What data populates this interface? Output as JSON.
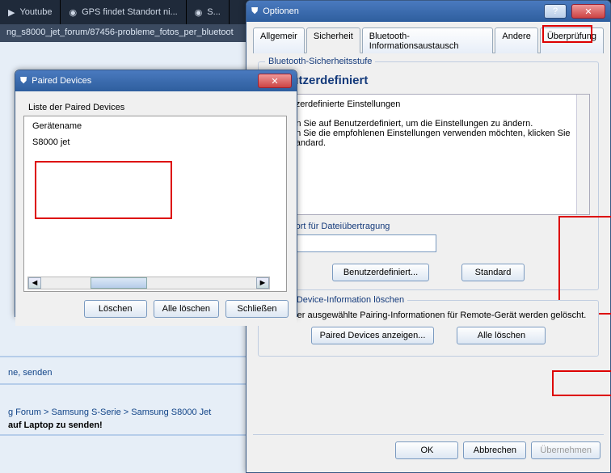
{
  "browser": {
    "tabs": [
      {
        "label": "Youtube",
        "icon": "youtube-icon"
      },
      {
        "label": "GPS findet Standort ni...",
        "icon": "globe-icon"
      },
      {
        "label": "S...",
        "icon": "globe-icon"
      }
    ],
    "url_fragment": "ng_s8000_jet_forum/87456-probleme_fotos_per_bluetoot"
  },
  "bg": {
    "tags": "ne, senden",
    "crumb1": "g Forum",
    "crumb2": "Samsung S-Serie",
    "crumb3": "Samsung S8000 Jet",
    "headline": "auf Laptop zu senden!"
  },
  "paired": {
    "title": "Paired Devices",
    "list_label": "Liste der Paired Devices",
    "col_header": "Gerätename",
    "row1": "S8000 jet",
    "btn_delete": "Löschen",
    "btn_delete_all": "Alle löschen",
    "btn_close": "Schließen"
  },
  "options": {
    "title": "Optionen",
    "tabs": {
      "general": "Allgemeir",
      "security": "Sicherheit",
      "bluetooth_info": "Bluetooth-Informationsaustausch",
      "other": "Andere",
      "check": "Überprüfung"
    },
    "group_security": "Bluetooth-Sicherheitsstufe",
    "level": "Benutzerdefiniert",
    "desc_line1": "Benutzerdefinierte Einstellungen",
    "desc_line2": "Klicken Sie auf Benutzerdefiniert, um die Einstellungen zu ändern.",
    "desc_line3": "- Wenn Sie die empfohlenen Einstellungen verwenden möchten, klicken Sie auf Standard.",
    "password_label": "Kennwort für Dateiübertragung",
    "password_value": "",
    "btn_custom": "Benutzerdefiniert...",
    "btn_default": "Standard",
    "group_paired": "Paired Device-Information löschen",
    "paired_text": "Alle oder ausgewählte Pairing-Informationen für Remote-Gerät werden gelöscht.",
    "btn_show_paired": "Paired Devices anzeigen...",
    "btn_delete_all": "Alle löschen",
    "btn_ok": "OK",
    "btn_cancel": "Abbrechen",
    "btn_apply": "Übernehmen"
  }
}
